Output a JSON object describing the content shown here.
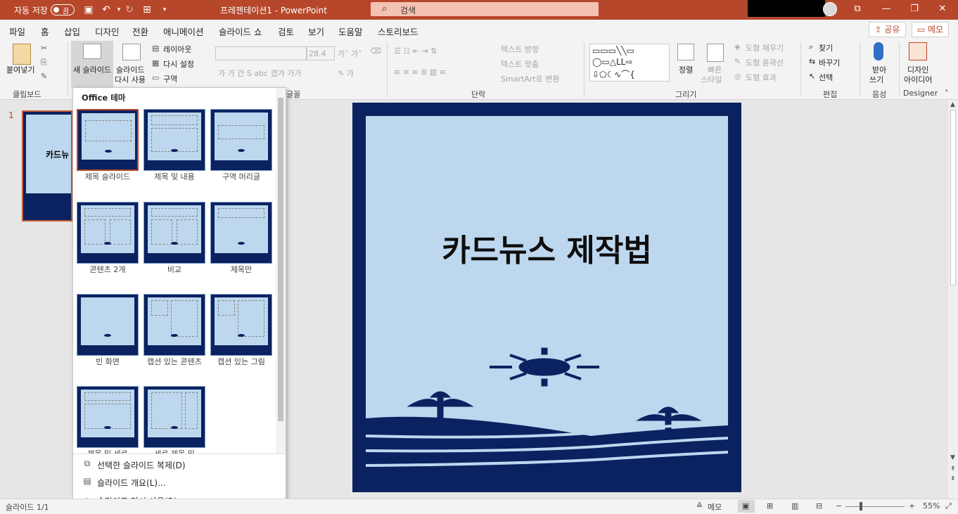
{
  "titlebar": {
    "autosave_label": "자동 저장",
    "autosave_state": "끔",
    "doc_title": "프레젠테이션1 - PowerPoint",
    "search_placeholder": "검색",
    "bg_color": "#b7472a"
  },
  "menubar": {
    "tabs": [
      "파일",
      "홈",
      "삽입",
      "디자인",
      "전환",
      "애니메이션",
      "슬라이드 쇼",
      "검토",
      "보기",
      "도움말",
      "스토리보드"
    ],
    "active_tab": "홈",
    "share_label": "공유",
    "memo_label": "메모"
  },
  "ribbon": {
    "clipboard": {
      "paste": "붙여넣기",
      "group": "클립보드"
    },
    "slides": {
      "new_slide": "새 슬라이드",
      "reuse": "슬라이드",
      "reuse2": "다시 사용",
      "layout": "레이아웃",
      "reset": "다시 설정",
      "section": "구역"
    },
    "font": {
      "size": "28.4",
      "group": "글꼴",
      "row2": "가 가 간 S abc 갰가 가가"
    },
    "paragraph": {
      "text_dir": "텍스트 방향",
      "align_text": "텍스트 맞춤",
      "smartart": "SmartArt로 변환",
      "group": "단락"
    },
    "drawing": {
      "arrange": "정렬",
      "quick_styles": "빠른",
      "quick_styles2": "스타일",
      "fill": "도형 채우기",
      "outline": "도형 윤곽선",
      "effects": "도형 효과",
      "group": "그리기"
    },
    "editing": {
      "find": "찾기",
      "replace": "바꾸기",
      "select": "선택",
      "group": "편집"
    },
    "voice": {
      "dictate": "받아",
      "dictate2": "쓰기",
      "group": "음성"
    },
    "designer": {
      "label": "디자인",
      "label2": "아이디어",
      "group": "Designer"
    }
  },
  "dropdown": {
    "header": "Office 테마",
    "layouts": [
      "제목 슬라이드",
      "제목 및 내용",
      "구역 머리글",
      "콘텐츠 2개",
      "비교",
      "제목만",
      "빈 화면",
      "캡션 있는 콘텐츠",
      "캡션 있는 그림",
      "제목 및 세로",
      "세로 제목 및"
    ],
    "commands": [
      "선택한 슬라이드 복제(D)",
      "슬라이드 개요(L)...",
      "슬라이드 다시 사용(R)"
    ]
  },
  "slide_panel": {
    "number": "1",
    "thumb_text": "카드뉴"
  },
  "slide": {
    "title": "카드뉴스 제작법",
    "frame_color": "#0a2260",
    "bg_color": "#bdd7ee"
  },
  "status": {
    "slide_info": "슬라이드 1/1",
    "notes": "메모",
    "zoom": "55%"
  }
}
